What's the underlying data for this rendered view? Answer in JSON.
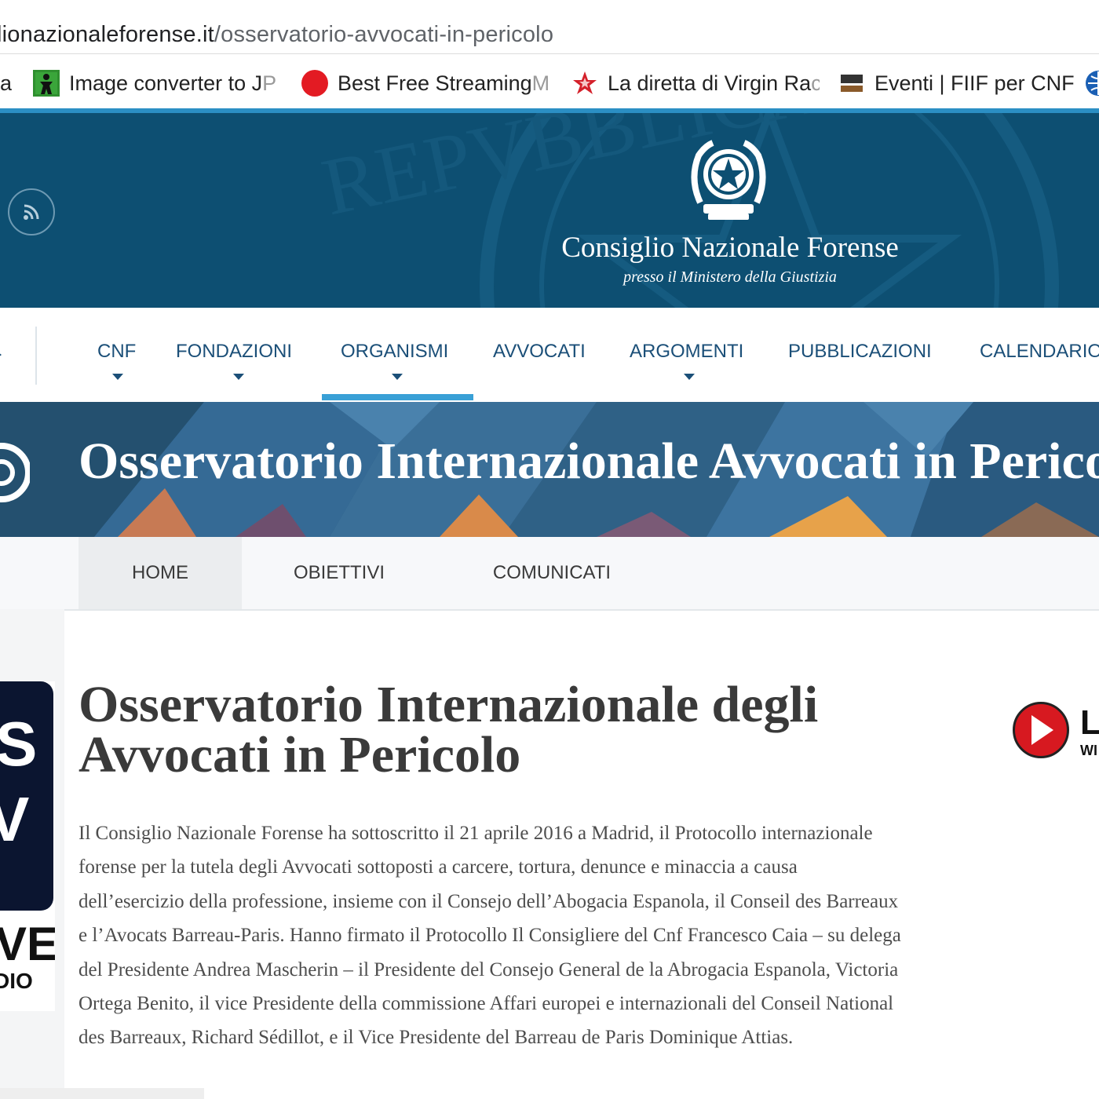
{
  "browser": {
    "url_domain": "lionazionaleforense.it",
    "url_path": "/osservatorio-avvocati-in-pericolo",
    "bookmarks": [
      {
        "label": "la",
        "faded": ""
      },
      {
        "label": "Image converter to J",
        "faded": "P"
      },
      {
        "label": "Best Free Streaming",
        "faded": " M"
      },
      {
        "label": "La diretta di Virgin Ra",
        "faded": "c"
      },
      {
        "label": "Eventi | FIIF per CNF",
        "faded": ""
      }
    ]
  },
  "header": {
    "title": "Consiglio Nazionale Forense",
    "subtitle": "presso il Ministero della Giustizia",
    "watermark": "REPVBBLICA ITALIANA"
  },
  "nav": {
    "items": [
      {
        "label": "CNF"
      },
      {
        "label": "FONDAZIONI"
      },
      {
        "label": "ORGANISMI"
      },
      {
        "label": "AVVOCATI"
      },
      {
        "label": "ARGOMENTI"
      },
      {
        "label": "PUBBLICAZIONI"
      },
      {
        "label": "CALENDARIO"
      }
    ]
  },
  "banner": {
    "title": "Osservatorio Internazionale Avvocati in Pericolo"
  },
  "subnav": {
    "items": [
      {
        "label": "HOME"
      },
      {
        "label": "OBIETTIVI"
      },
      {
        "label": "COMUNICATI"
      }
    ]
  },
  "ads": {
    "left_text_1": "S",
    "left_text_2": "V",
    "left_text_3": "VE",
    "left_text_4": "DIO",
    "right_text_1": "L",
    "right_text_2": "WI"
  },
  "article": {
    "title": "Osservatorio Internazionale degli Avvocati in Pericolo",
    "lines": [
      "Il Consiglio Nazionale Forense ha sottoscritto il 21 aprile 2016 a Madrid, il Protocollo internazionale",
      "forense per la tutela degli Avvocati sottoposti a carcere, tortura, denunce  e minaccia a causa",
      "dell’esercizio della professione, insieme con il Consejo dell’Abogacia Espanola, il  Conseil des Barreaux",
      "e l’Avocats Barreau-Paris. Hanno firmato il Protocollo Il Consigliere del Cnf  Francesco Caia – su delega",
      "del Presidente Andrea Mascherin – il  Presidente del Consejo General de la Abrogacia Espanola, Victoria",
      "Ortega Benito, il vice Presidente della commissione Affari europei e internazionali del Conseil National",
      "des Barreaux, Richard Sédillot, e il Vice Presidente del Barreau de Paris  Dominique Attias."
    ]
  }
}
